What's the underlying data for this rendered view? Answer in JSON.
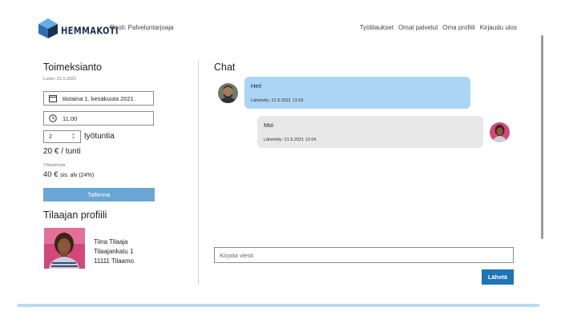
{
  "header": {
    "logo_text": "HEMMAKOTI",
    "role": "Rooli: Palveluntarjoaja",
    "nav": [
      "Työtilaukset",
      "Omat palvelut",
      "Oma profiili",
      "Kirjaudu ulos"
    ]
  },
  "assignment": {
    "title": "Toimeksianto",
    "created": "Luotu: 21.5.2021",
    "date": "tiistaina 1. kesäkuuta 2021",
    "time": "11.00",
    "hours": "2",
    "hours_label": "työtuntia",
    "rate": "20 € / tunti",
    "total_label": "Yhteishinta",
    "total_value": "40 €",
    "total_vat": "sis. alv (24%)",
    "save_label": "Tallenna"
  },
  "customer": {
    "title": "Tilaajan profiili",
    "name": "Tiina Tilaaja",
    "street": "Tilaajankatu 1",
    "city": "11111 Tilaamo"
  },
  "chat": {
    "title": "Chat",
    "messages": [
      {
        "text": "Hei!",
        "sent": "Lähetetty: 21.5.2021 13.03"
      },
      {
        "text": "Moi",
        "sent": "Lähetetty: 21.5.2021 13.04"
      }
    ],
    "input_placeholder": "Kirjoita viesti",
    "send_label": "Lähetä"
  },
  "colors": {
    "brand": "#1b2f52",
    "accent": "#1f73b7",
    "save_button": "#6aa7d6",
    "incoming_bubble": "#acd4f4",
    "outgoing_bubble": "#e8e8e8",
    "footer_bar": "#b9dbf3"
  }
}
